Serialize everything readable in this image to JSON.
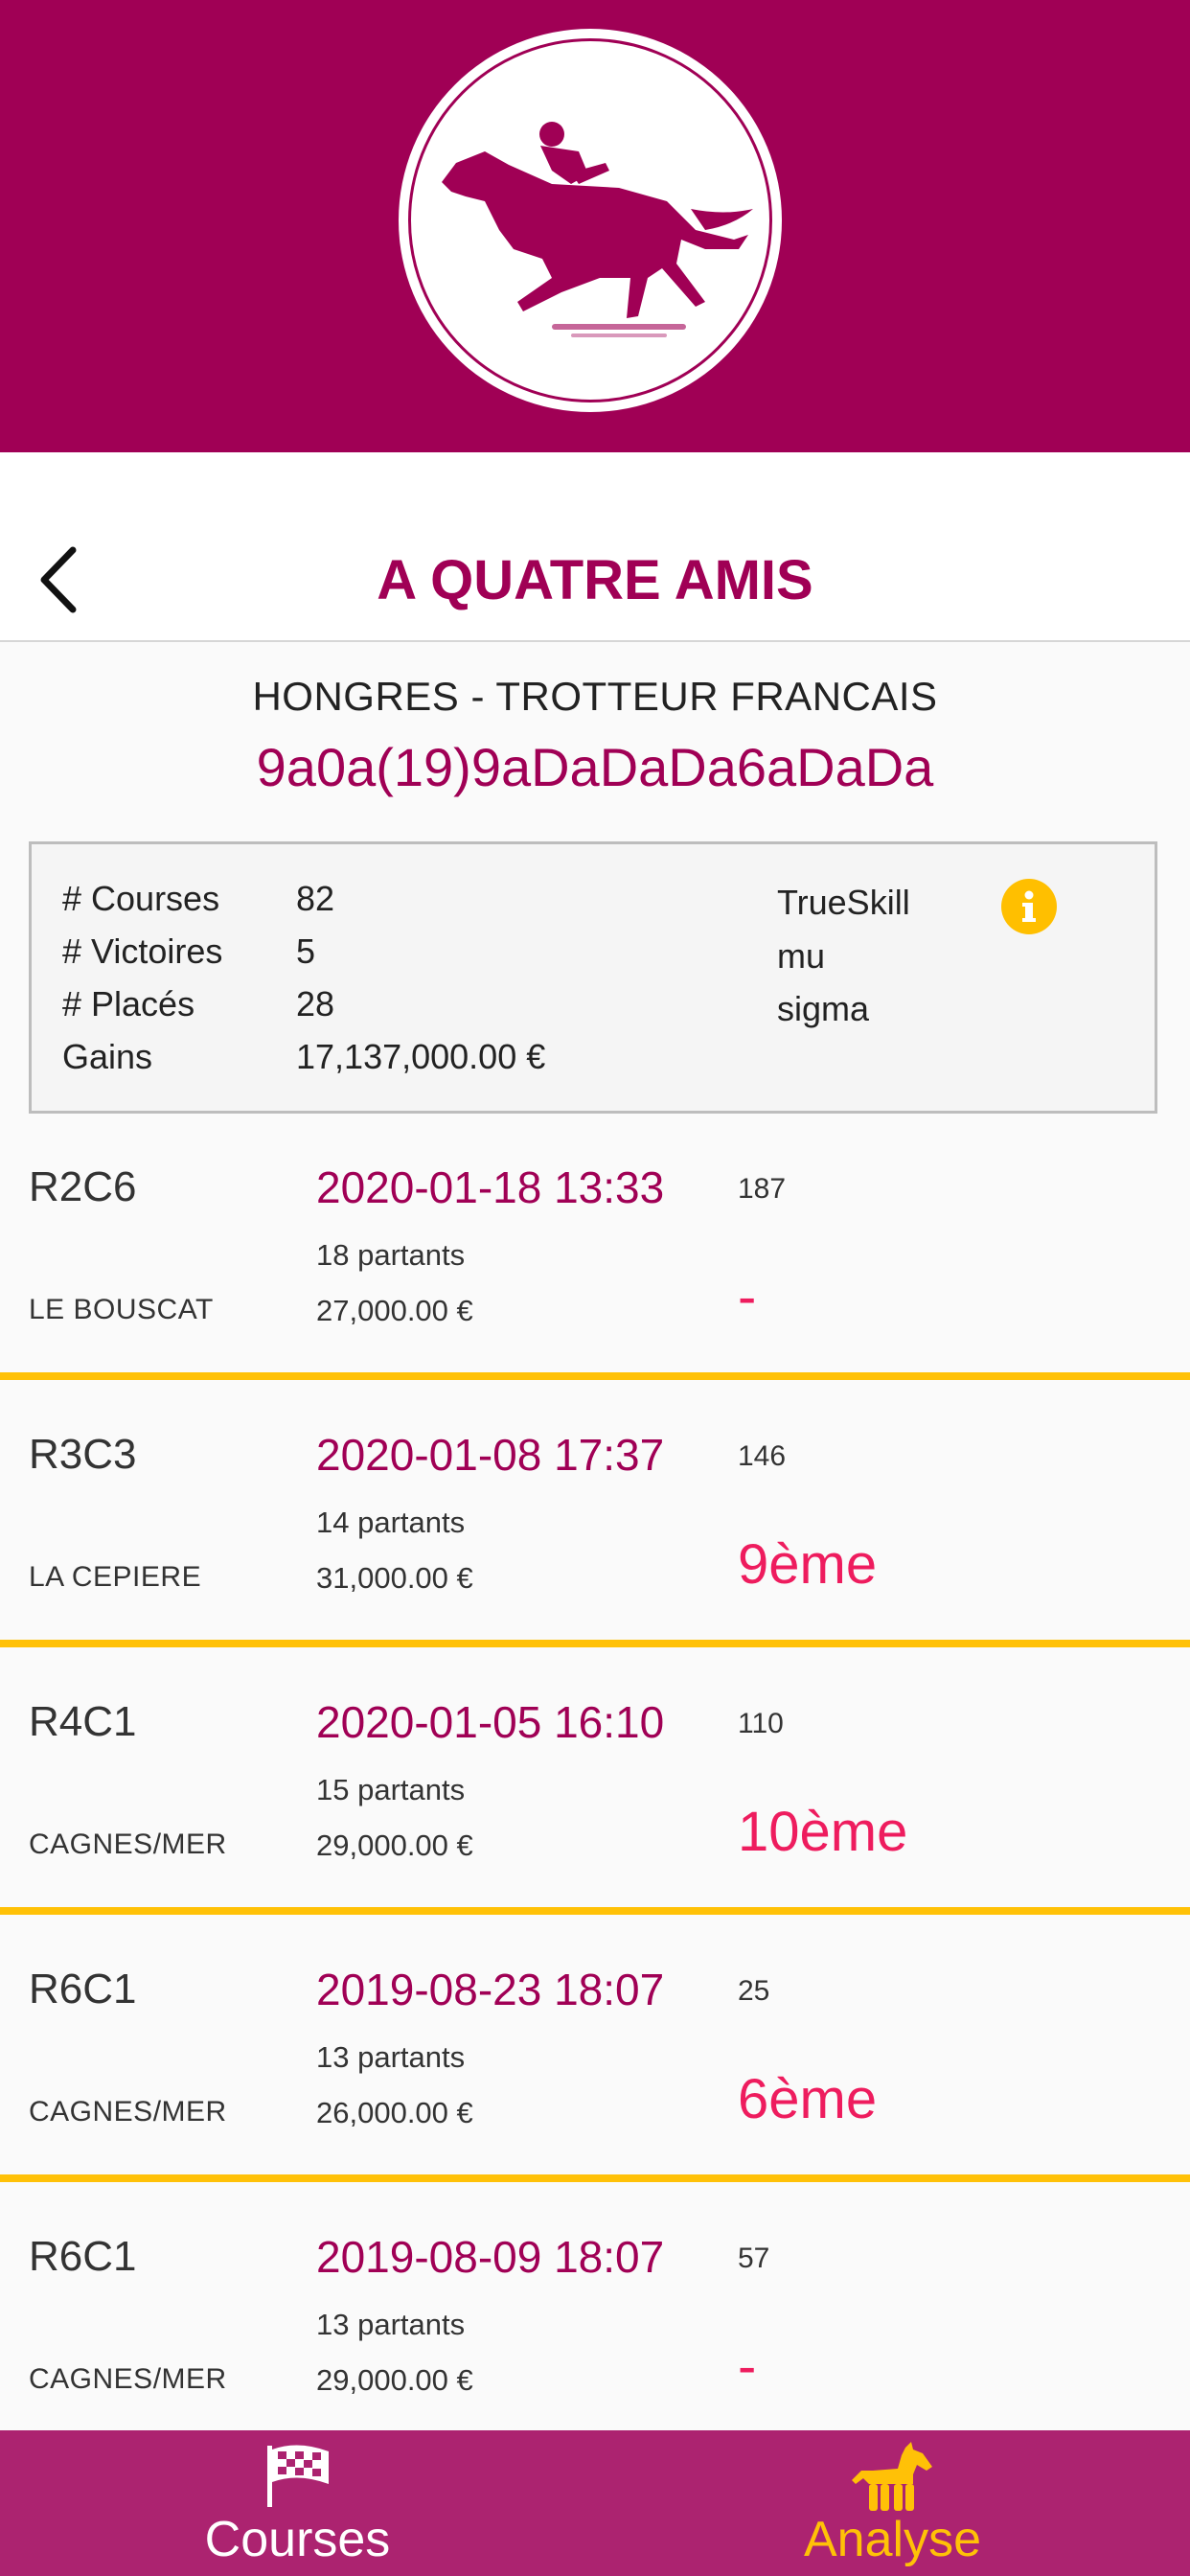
{
  "header": {
    "logo_icon": "jockey-horse-logo",
    "brand_color": "#a00055"
  },
  "nav": {
    "back_icon": "chevron-left-icon",
    "title": "A QUATRE AMIS"
  },
  "horse": {
    "breed": "HONGRES - TROTTEUR FRANCAIS",
    "code": "9a0a(19)9aDaDaDa6aDaDa"
  },
  "stats": {
    "rows": [
      {
        "label": "# Courses",
        "value": "82"
      },
      {
        "label": "# Victoires",
        "value": "5"
      },
      {
        "label": "# Placés",
        "value": "28"
      },
      {
        "label": "Gains",
        "value": "17,137,000.00 €"
      }
    ],
    "trueskill": {
      "title": "TrueSkill",
      "mu": "mu",
      "sigma": "sigma",
      "info_icon": "info-icon",
      "info_color": "#ffbf00"
    }
  },
  "races": [
    {
      "id": "R2C6",
      "venue": "LE BOUSCAT",
      "datetime": "2020-01-18 13:33",
      "partants": "18 partants",
      "prize": "27,000.00 €",
      "number": "187",
      "place": "-"
    },
    {
      "id": "R3C3",
      "venue": "LA CEPIERE",
      "datetime": "2020-01-08 17:37",
      "partants": "14 partants",
      "prize": "31,000.00 €",
      "number": "146",
      "place": "9ème"
    },
    {
      "id": "R4C1",
      "venue": "CAGNES/MER",
      "datetime": "2020-01-05 16:10",
      "partants": "15 partants",
      "prize": "29,000.00 €",
      "number": "110",
      "place": "10ème"
    },
    {
      "id": "R6C1",
      "venue": "CAGNES/MER",
      "datetime": "2019-08-23 18:07",
      "partants": "13 partants",
      "prize": "26,000.00 €",
      "number": "25",
      "place": "6ème"
    },
    {
      "id": "R6C1",
      "venue": "CAGNES/MER",
      "datetime": "2019-08-09 18:07",
      "partants": "13 partants",
      "prize": "29,000.00 €",
      "number": "57",
      "place": "-"
    }
  ],
  "tabbar": {
    "tabs": [
      {
        "label": "Courses",
        "icon": "checkered-flag-icon",
        "active": false,
        "color": "#ffffff"
      },
      {
        "label": "Analyse",
        "icon": "horse-icon",
        "active": true,
        "color": "#ffc107"
      }
    ]
  }
}
